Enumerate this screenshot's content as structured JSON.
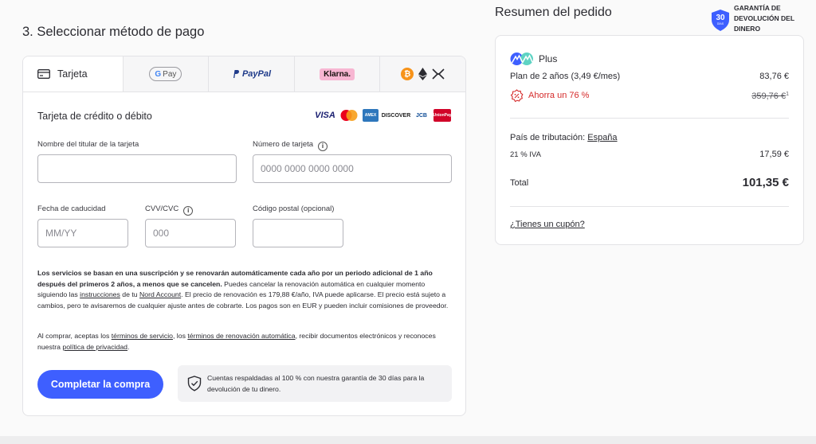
{
  "left": {
    "section_title": "3. Seleccionar método de pago",
    "tabs": [
      {
        "label": "Tarjeta",
        "icon": "credit-card-icon"
      },
      {
        "label": "Pay",
        "icon": "google-pay-icon"
      },
      {
        "label": "PayPal",
        "icon": "paypal-icon"
      },
      {
        "label": "Klarna.",
        "icon": "klarna-icon"
      },
      {
        "label": "",
        "icon": "crypto-icons"
      }
    ],
    "card_form_title": "Tarjeta de crédito o débito",
    "brands": [
      "VISA",
      "Mastercard",
      "AMEX",
      "DISCOVER",
      "JCB",
      "UnionPay"
    ],
    "fields": {
      "holder_label": "Nombre del titular de la tarjeta",
      "number_label": "Número de tarjeta",
      "number_placeholder": "0000 0000 0000 0000",
      "expiry_label": "Fecha de caducidad",
      "expiry_placeholder": "MM/YY",
      "cvv_label": "CVV/CVC",
      "cvv_placeholder": "000",
      "postal_label": "Código postal (opcional)"
    },
    "legal": {
      "bold": "Los servicios se basan en una suscripción y se renovarán automáticamente cada año por un periodo adicional de 1 año después del primeros 2 años, a menos que se cancelen.",
      "t1": " Puedes cancelar la renovación automática en cualquier momento siguiendo las ",
      "link_instructions": "instrucciones",
      "t2": " de tu ",
      "link_account": "Nord Account",
      "t3": ". El precio de renovación es 179,88 €/año, IVA puede aplicarse. El precio está sujeto a cambios, pero te avisaremos de cualquier ajuste antes de cobrarte. Los pagos son en EUR y pueden incluir comisiones de proveedor."
    },
    "terms": {
      "t1": "Al comprar, aceptas los ",
      "link_tos": "términos de servicio",
      "t2": ", los ",
      "link_renewal": "términos de renovación automática",
      "t3": ", recibir documentos electrónicos y reconoces nuestra ",
      "link_privacy": "política de privacidad",
      "t4": "."
    },
    "cta_label": "Completar la compra",
    "guarantee_text": "Cuentas respaldadas al 100 % con nuestra garantía de 30 días para la devolución de tu dinero."
  },
  "right": {
    "summary_title": "Resumen del pedido",
    "badge_number": "30",
    "badge_small": "DÍAS",
    "badge_text_1": "GARANTÍA DE",
    "badge_text_2": "DEVOLUCIÓN DEL",
    "badge_text_3": "DINERO",
    "plan_name": "Plus",
    "plan_line": "Plan de 2 años (3,49 €/mes)",
    "plan_price": "83,76 €",
    "savings_label": "Ahorra un 76 %",
    "old_price": "359,76 €",
    "old_price_footnote": "1",
    "tax_country_label": "País de tributación: ",
    "tax_country": "España",
    "vat_label": "21 % IVA",
    "vat_amount": "17,59 €",
    "total_label": "Total",
    "total_amount": "101,35 €",
    "coupon_link": "¿Tienes un cupón?"
  },
  "colors": {
    "accent": "#3e5fff",
    "savings": "#d52b2b",
    "badge": "#3e5fff"
  }
}
